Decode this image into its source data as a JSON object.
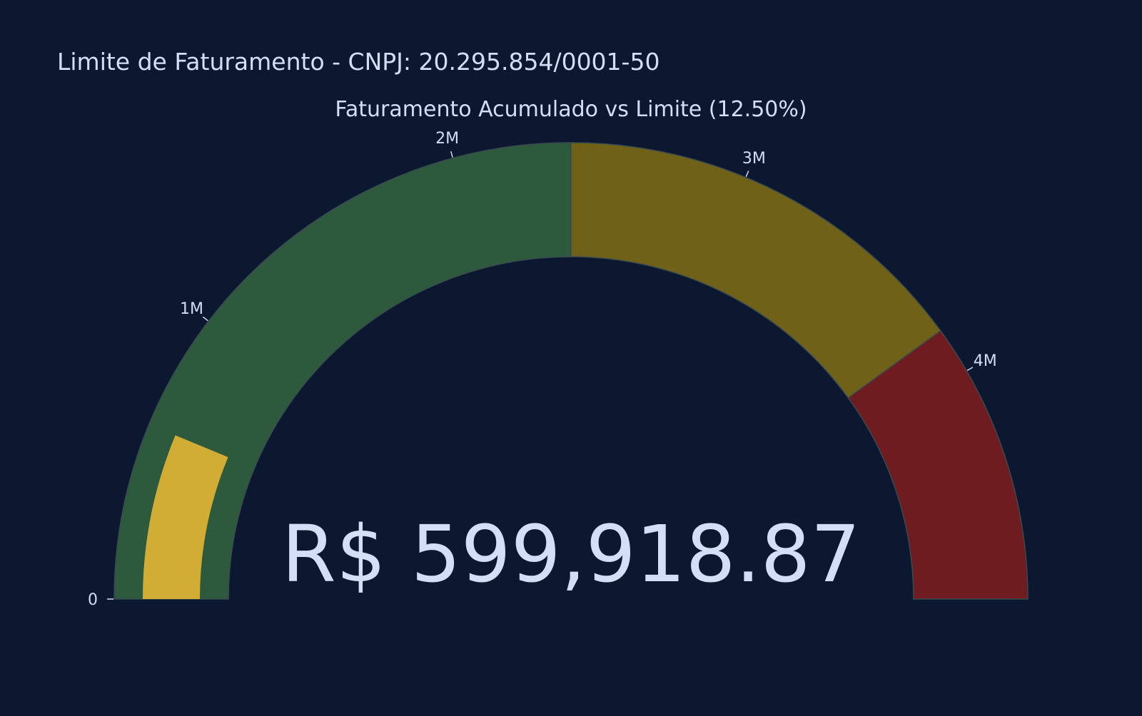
{
  "page": {
    "title": "Limite de Faturamento - CNPJ: 20.295.854/0001-50"
  },
  "colors": {
    "background": "#0b1830",
    "text": "#d4def5",
    "bar": "#d2ad36",
    "border": "#3a4a4f"
  },
  "chart_data": {
    "type": "gauge",
    "title": "Faturamento Acumulado vs Limite (12.50%)",
    "value": 599918.87,
    "value_label": "R$ 599,918.87",
    "range": [
      0,
      4800000
    ],
    "percent_of_limit": 12.5,
    "steps": [
      {
        "range": [
          0,
          2400000
        ],
        "color": "#2d5a3c"
      },
      {
        "range": [
          2400000,
          3840000
        ],
        "color": "#6f6218"
      },
      {
        "range": [
          3840000,
          4800000
        ],
        "color": "#6e1c1f"
      }
    ],
    "ticks": [
      {
        "value": 0,
        "label": "0"
      },
      {
        "value": 1000000,
        "label": "1M"
      },
      {
        "value": 2000000,
        "label": "2M"
      },
      {
        "value": 3000000,
        "label": "3M"
      },
      {
        "value": 4000000,
        "label": "4M"
      }
    ]
  }
}
